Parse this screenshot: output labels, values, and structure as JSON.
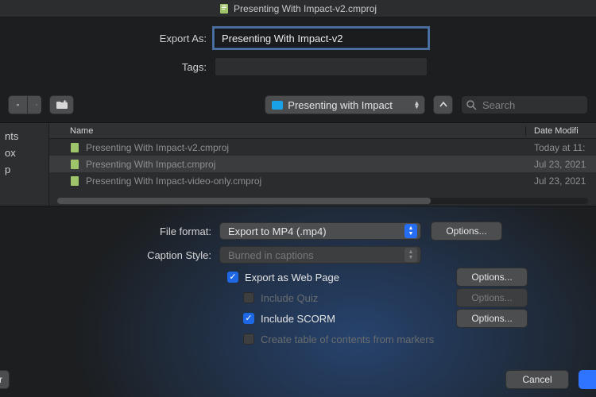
{
  "title": "Presenting With Impact-v2.cmproj",
  "form": {
    "export_as_label": "Export As:",
    "export_as_value": "Presenting With Impact-v2",
    "tags_label": "Tags:",
    "tags_value": ""
  },
  "toolbar": {
    "folder_name": "Presenting with Impact",
    "search_placeholder": "Search"
  },
  "sidebar": {
    "items": [
      "nts",
      "ox",
      "p"
    ]
  },
  "filelist": {
    "columns": {
      "name": "Name",
      "date": "Date Modifi"
    },
    "rows": [
      {
        "name": "Presenting With Impact-v2.cmproj",
        "date": "Today at 11:"
      },
      {
        "name": "Presenting With Impact.cmproj",
        "date": "Jul 23, 2021"
      },
      {
        "name": "Presenting With Impact-video-only.cmproj",
        "date": "Jul 23, 2021"
      }
    ]
  },
  "settings": {
    "file_format_label": "File format:",
    "file_format_value": "Export to MP4 (.mp4)",
    "caption_style_label": "Caption Style:",
    "caption_style_value": "Burned in captions",
    "options_label": "Options...",
    "checks": {
      "web_page": {
        "label": "Export as Web Page",
        "checked": true,
        "has_options": true,
        "options_enabled": true
      },
      "include_quiz": {
        "label": "Include Quiz",
        "checked": false,
        "disabled": true,
        "has_options": true,
        "options_enabled": false
      },
      "include_scorm": {
        "label": "Include SCORM",
        "checked": true,
        "has_options": true,
        "options_enabled": true
      },
      "toc": {
        "label": "Create table of contents from markers",
        "checked": false,
        "disabled": true,
        "has_options": false
      }
    }
  },
  "buttons": {
    "left_truncated": "r",
    "cancel": "Cancel",
    "export": " "
  }
}
